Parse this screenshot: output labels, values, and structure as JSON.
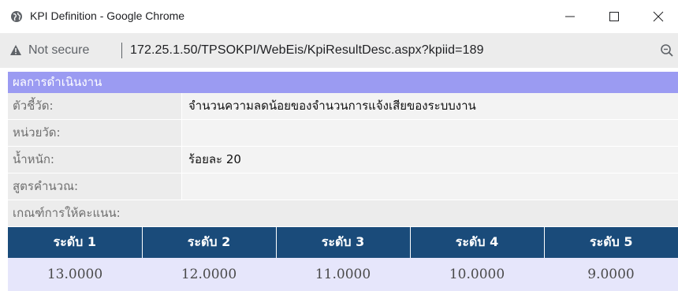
{
  "window": {
    "title": "KPI Definition - Google Chrome",
    "controls": {
      "minimize": "minimize-icon",
      "maximize": "maximize-icon",
      "close": "close-icon"
    }
  },
  "address_bar": {
    "security_label": "Not secure",
    "url": "172.25.1.50/TPSOKPI/WebEis/KpiResultDesc.aspx?kpiid=189"
  },
  "section": {
    "header": "ผลการดำเนินงาน"
  },
  "fields": [
    {
      "label": "ตัวชี้วัด:",
      "value": "จำนวนความลดน้อยของจำนวนการแจ้งเสียของระบบงาน"
    },
    {
      "label": "หน่วยวัด:",
      "value": ""
    },
    {
      "label": "น้ำหนัก:",
      "value": "ร้อยละ 20"
    },
    {
      "label": "สูตรคำนวณ:",
      "value": ""
    }
  ],
  "criteria_label": "เกณฑ์การให้คะแนน:",
  "levels": {
    "headers": [
      "ระดับ 1",
      "ระดับ 2",
      "ระดับ 3",
      "ระดับ 4",
      "ระดับ 5"
    ],
    "values": [
      "13.0000",
      "12.0000",
      "11.0000",
      "10.0000",
      "9.0000"
    ]
  },
  "colors": {
    "section_header_bg": "#9b9bf2",
    "level_header_bg": "#1a4b7a",
    "level_value_bg": "#e6e6fb"
  }
}
